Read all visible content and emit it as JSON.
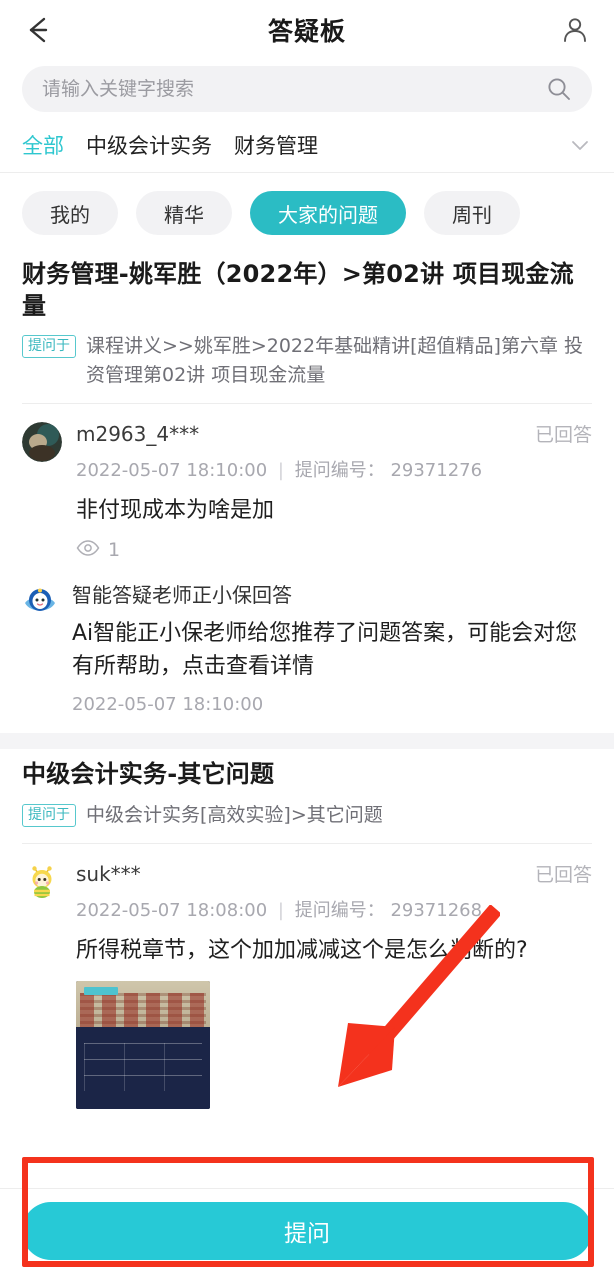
{
  "header": {
    "title": "答疑板",
    "back_icon": "back-arrow-icon",
    "profile_icon": "person-icon"
  },
  "search": {
    "placeholder": "请输入关键字搜索",
    "value": "",
    "icon": "search-icon"
  },
  "category_tabs": {
    "items": [
      {
        "label": "全部",
        "active": true
      },
      {
        "label": "中级会计实务",
        "active": false
      },
      {
        "label": "财务管理",
        "active": false
      }
    ],
    "expand_icon": "chevron-down-icon"
  },
  "filter_chips": [
    {
      "label": "我的",
      "active": false
    },
    {
      "label": "精华",
      "active": false
    },
    {
      "label": "大家的问题",
      "active": true
    },
    {
      "label": "周刊",
      "active": false
    }
  ],
  "groups": [
    {
      "title": "财务管理-姚军胜（2022年）>第02讲  项目现金流量",
      "source_tag": "提问于",
      "source_text": "课程讲义>>姚军胜>2022年基础精讲[超值精品]第六章  投资管理第02讲  项目现金流量",
      "post": {
        "username": "m2963_4***",
        "status": "已回答",
        "time": "2022-05-07 18:10:00",
        "id_label": "提问编号：",
        "id_value": "29371276",
        "question": "非付现成本为啥是加",
        "views": "1",
        "views_icon": "eye-icon"
      },
      "ai_answer": {
        "avatar_icon": "ai-assistant-avatar-icon",
        "title": "智能答疑老师正小保回答",
        "text": "Ai智能正小保老师给您推荐了问题答案，可能会对您有所帮助，点击查看详情",
        "time": "2022-05-07 18:10:00"
      }
    },
    {
      "title": "中级会计实务-其它问题",
      "source_tag": "提问于",
      "source_text": "中级会计实务[高效实验]>其它问题",
      "post": {
        "username": "suk***",
        "status": "已回答",
        "time": "2022-05-07 18:08:00",
        "id_label": "提问编号：",
        "id_value": "29371268",
        "question": "所得税章节，这个加加减减这个是怎么判断的?",
        "attachment_alt": "question-attachment-thumbnail"
      }
    }
  ],
  "cta": {
    "label": "提问"
  },
  "annotations": {
    "arrow": "red-pointer-arrow",
    "highlight_box": "red-highlight-box",
    "color": "#f4321d"
  },
  "colors": {
    "accent": "#27c9d6",
    "chip_active": "#2bbcc4",
    "tab_active": "#2ec7cf",
    "annotation": "#f4321d"
  }
}
